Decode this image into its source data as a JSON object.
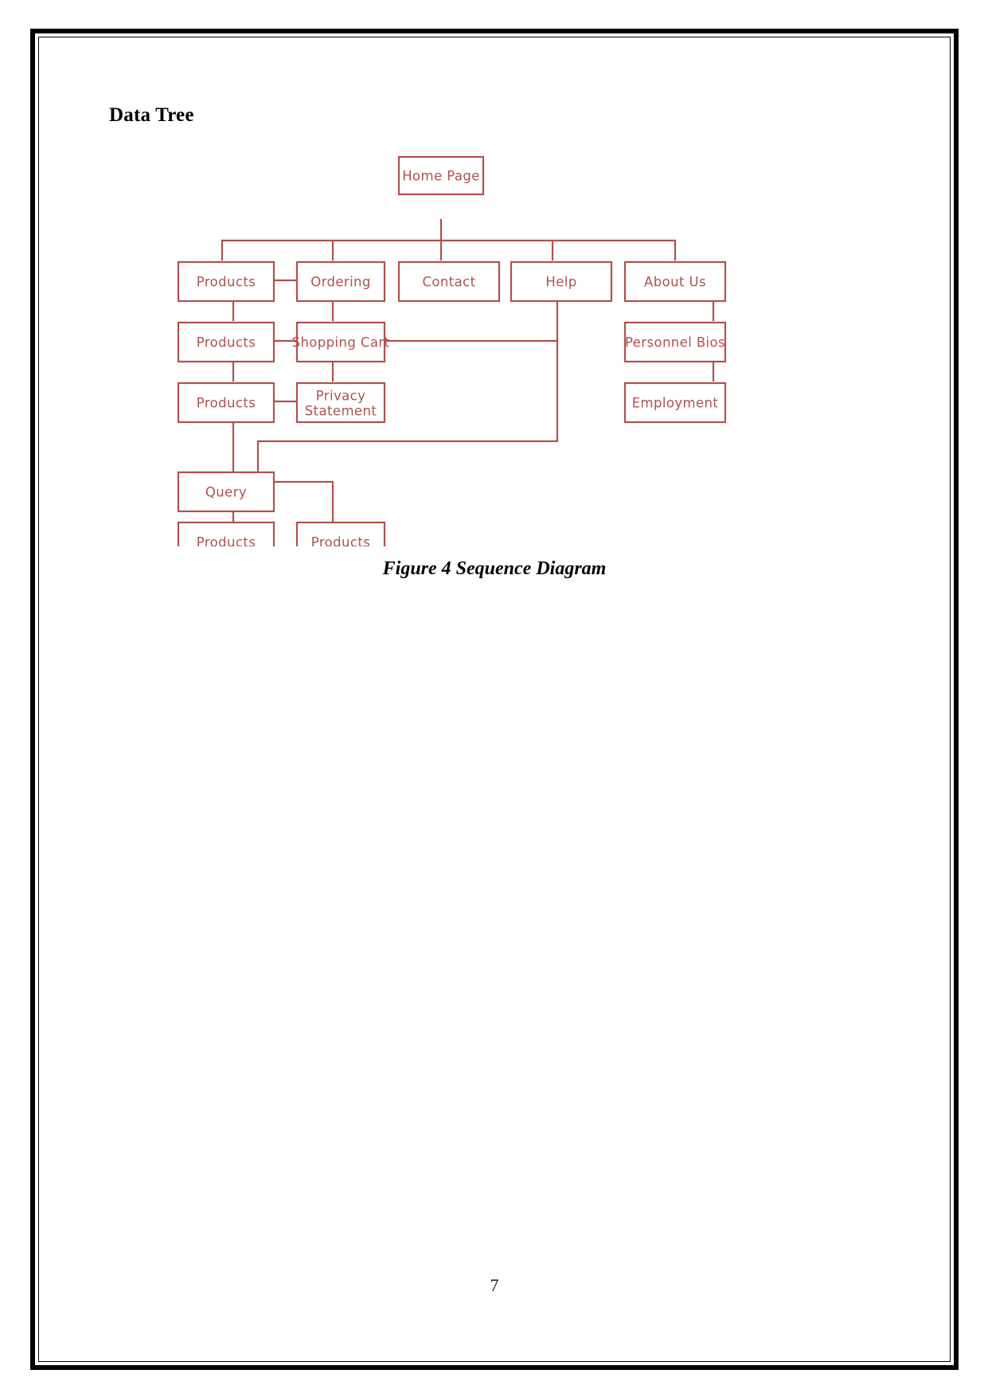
{
  "page": {
    "heading": "Data Tree",
    "figure_caption": "Figure 4 Sequence Diagram",
    "page_number": "7",
    "border_color": "#000000",
    "background_color": "#ffffff"
  },
  "diagram": {
    "title": "Data Tree",
    "type": "tree",
    "accent_color": "#b0514d",
    "node_fill": "#ffffff",
    "nodes": {
      "home_page": "Home Page",
      "products_l1": "Products",
      "ordering": "Ordering",
      "contact": "Contact",
      "help": "Help",
      "about_us": "About Us",
      "products_l2": "Products",
      "shopping_cart": "Shopping Cart",
      "personnel_bios": "Personnel Bios",
      "products_l3": "Products",
      "privacy_statement_line1": "Privacy",
      "privacy_statement_line2": "Statement",
      "employment": "Employment",
      "query": "Query",
      "products_l4_left": "Products",
      "products_l4_right": "Products"
    },
    "edges": [
      "home_page -> products_l1",
      "home_page -> ordering",
      "home_page -> contact",
      "home_page -> help",
      "home_page -> about_us",
      "products_l1 -> ordering",
      "products_l1 -> products_l2",
      "ordering -> shopping_cart",
      "products_l2 -> shopping_cart",
      "products_l2 -> products_l3",
      "shopping_cart -> privacy_statement",
      "shopping_cart -> help",
      "products_l3 -> privacy_statement",
      "products_l3 -> query",
      "help -> query",
      "about_us -> personnel_bios",
      "personnel_bios -> employment",
      "query -> products_l4_left",
      "query -> products_l4_right"
    ]
  }
}
